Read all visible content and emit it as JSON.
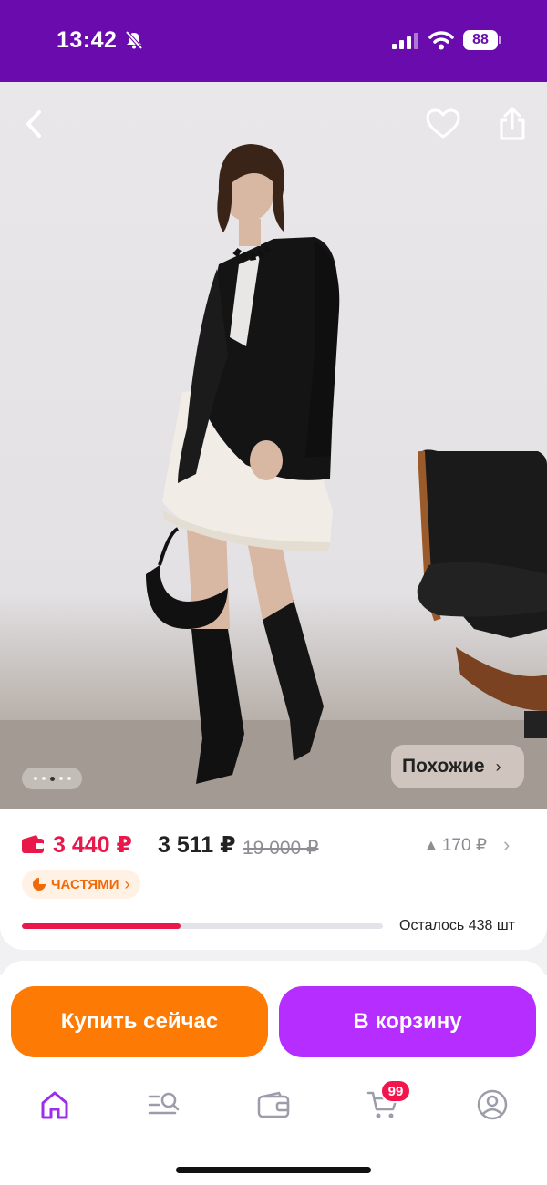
{
  "status_bar": {
    "time": "13:42",
    "battery": "88"
  },
  "product_gallery": {
    "similar_label": "Похожие",
    "image_count": 5,
    "active_index": 2
  },
  "pricing": {
    "wallet_price": "3 440 ₽",
    "price": "3 511 ₽",
    "old_price": "19 000 ₽",
    "price_diff": "170 ₽",
    "installments_label": "ЧАСТЯМИ",
    "stock_text": "Осталось 438 шт",
    "stock_fraction": 0.44
  },
  "actions": {
    "buy_now": "Купить сейчас",
    "add_to_cart": "В корзину"
  },
  "bottom_nav": {
    "cart_badge": "99"
  },
  "colors": {
    "brand": "#6a0cad",
    "buy": "#fd7a05",
    "cart": "#b52eff",
    "sale": "#e8194a"
  }
}
